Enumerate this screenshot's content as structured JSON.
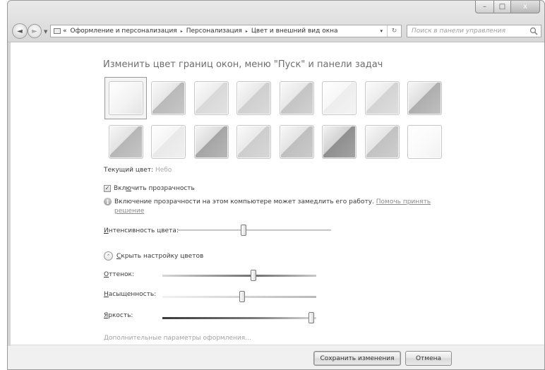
{
  "window": {
    "caption": {
      "minimize": "–",
      "maximize": "□",
      "close": "x"
    }
  },
  "nav": {
    "back_glyph": "◄",
    "forward_glyph": "►",
    "dropdown_glyph": "▼",
    "breadcrumb_prefix": "«",
    "breadcrumbs": [
      "Оформление и персонализация",
      "Персонализация",
      "Цвет и внешний вид окна"
    ],
    "separator": "▸",
    "address_dropdown": "▾",
    "refresh_glyph": "↻",
    "search_placeholder": "Поиск в панели управления"
  },
  "page": {
    "title": "Изменить цвет границ окон, меню \"Пуск\" и панели задач",
    "swatches": {
      "selected_index": 0,
      "count": 16,
      "tones": [
        "#f3f3f3",
        "#c8c8c8",
        "#e2e2e2",
        "#dadada",
        "#d2d2d2",
        "#f3f3f3",
        "#dfdfdf",
        "#c0c0c0",
        "#c6c6c6",
        "#f0f0f0",
        "#b7b7b7",
        "#d8d8d8",
        "#cbcbcb",
        "#a3a3a3",
        "#cfcfcf",
        "#f1f1f1"
      ]
    },
    "current_color": {
      "label": "Текущий цвет:",
      "value": "Небо"
    },
    "transparency": {
      "checked": true,
      "check_glyph": "✓",
      "label_pre": "Вкл",
      "label_ul": "ю",
      "label_post": "чить прозрачность"
    },
    "info": {
      "glyph": "i",
      "text": "Включение прозрачности на этом компьютере может замедлить его работу.",
      "link_part1": "Помочь принять",
      "link_part2": "решение"
    },
    "intensity": {
      "label_ul": "И",
      "label_rest": "нтенсивность цвета:",
      "value": 0.43
    },
    "mixer_toggle": {
      "glyph": "⌃",
      "label_ul": "С",
      "label_rest": "крыть настройку цветов"
    },
    "hue": {
      "label_ul": "О",
      "label_rest": "ттенок:",
      "value": 0.59
    },
    "saturation": {
      "label_ul": "Н",
      "label_rest": "асыщенность:",
      "value": 0.52
    },
    "brightness": {
      "label_ul": "Я",
      "label_rest": "ркость:",
      "value": 0.97
    },
    "advanced_link": "Дополнительные параметры оформления..."
  },
  "footer": {
    "save_label": "Сохранить изменения",
    "cancel_label": "Отмена"
  }
}
